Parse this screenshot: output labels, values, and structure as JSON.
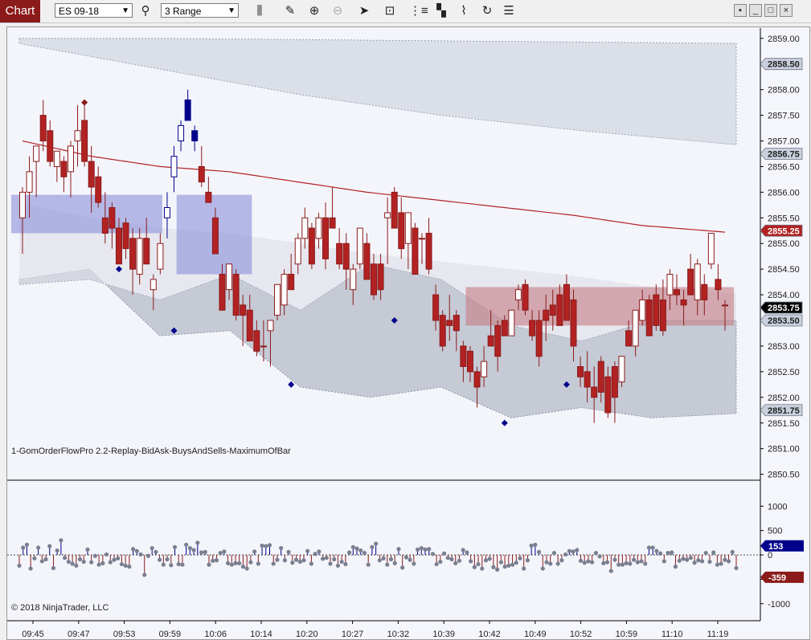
{
  "toolbar": {
    "chart_tab": "Chart",
    "instrument": "ES 09-18",
    "interval": "3 Range",
    "icons": [
      "bars-type-icon",
      "pencil-draw-icon",
      "zoom-in-icon",
      "zoom-out-icon",
      "pointer-icon",
      "data-box-icon",
      "properties-icon",
      "strategies-icon",
      "indicators-icon",
      "reload-icon",
      "template-list-icon"
    ]
  },
  "window_buttons": {
    "minimize": "_",
    "maximize": "□",
    "close": "×"
  },
  "price_axis": {
    "ticks": [
      "2859.00",
      "2858.50",
      "2858.00",
      "2857.50",
      "2857.00",
      "2856.50",
      "2856.00",
      "2855.50",
      "2855.00",
      "2854.50",
      "2854.00",
      "2853.50",
      "2853.00",
      "2852.50",
      "2852.00",
      "2851.50",
      "2851.00",
      "2850.50"
    ],
    "markers": [
      {
        "value": "2858.50",
        "color": "#c9d0dc",
        "dark": false
      },
      {
        "value": "2856.75",
        "color": "#c9d0dc",
        "dark": false
      },
      {
        "value": "2855.25",
        "color": "#b22222",
        "dark": true
      },
      {
        "value": "2853.75",
        "color": "#000000",
        "dark": true
      },
      {
        "value": "2853.50",
        "color": "#c9d0dc",
        "dark": false
      },
      {
        "value": "2851.75",
        "color": "#c9d0dc",
        "dark": false
      }
    ]
  },
  "indicator_axis": {
    "ticks": [
      "1000",
      "500",
      "0",
      "-500",
      "-1000"
    ],
    "markers": [
      {
        "value": "153",
        "color": "#00008b"
      },
      {
        "value": "-359",
        "color": "#8b1a1a"
      }
    ]
  },
  "time_axis": [
    "09:45",
    "09:47",
    "09:53",
    "09:59",
    "10:06",
    "10:14",
    "10:20",
    "10:27",
    "10:32",
    "10:39",
    "10:42",
    "10:49",
    "10:52",
    "10:59",
    "11:10",
    "11:19"
  ],
  "plot_label": "1-GomOrderFlowPro 2.2-Replay-BidAsk-BuysAndSells-MaximumOfBar",
  "copyright": "© 2018 NinjaTrader, LLC",
  "colors": {
    "up": "#ffffff",
    "down": "#b22222",
    "band": "#c7ccd6",
    "zone_blue": "#8b90d8",
    "zone_red": "#c47c84",
    "vwap": "#b22222"
  },
  "chart_data": {
    "type": "candlestick",
    "symbol": "ES 09-18",
    "bar_type": "3 Range",
    "price_range": [
      2850.4,
      2859.2
    ],
    "indicator_range": [
      -1350,
      1500
    ],
    "candles": [
      [
        2855.5,
        2856.1,
        2854.8,
        2856.0
      ],
      [
        2856.0,
        2856.7,
        2855.5,
        2856.4
      ],
      [
        2856.6,
        2856.8,
        2855.9,
        2856.9
      ],
      [
        2857.5,
        2857.8,
        2856.8,
        2857.0
      ],
      [
        2857.2,
        2857.4,
        2856.5,
        2856.6
      ],
      [
        2856.5,
        2856.8,
        2856.2,
        2856.8
      ],
      [
        2856.6,
        2856.7,
        2856.0,
        2856.3
      ],
      [
        2856.4,
        2857.0,
        2855.9,
        2856.9
      ],
      [
        2857.0,
        2857.7,
        2856.5,
        2857.2
      ],
      [
        2857.4,
        2857.8,
        2856.5,
        2856.6
      ],
      [
        2856.6,
        2856.9,
        2855.6,
        2856.1
      ],
      [
        2856.3,
        2856.5,
        2855.7,
        2855.8
      ],
      [
        2855.5,
        2856.0,
        2855.0,
        2855.2
      ],
      [
        2855.7,
        2855.8,
        2854.9,
        2855.3
      ],
      [
        2855.3,
        2855.5,
        2854.6,
        2854.6
      ],
      [
        2855.4,
        2855.5,
        2854.7,
        2854.9
      ],
      [
        2855.1,
        2855.3,
        2854.0,
        2854.5
      ],
      [
        2854.4,
        2855.3,
        2854.2,
        2855.1
      ],
      [
        2855.1,
        2855.5,
        2854.6,
        2854.6
      ],
      [
        2854.1,
        2854.4,
        2853.7,
        2854.3
      ],
      [
        2854.5,
        2855.2,
        2854.4,
        2855.0
      ],
      [
        2855.5,
        2856.0,
        2855.1,
        2855.7
      ],
      [
        2856.3,
        2856.9,
        2856.0,
        2856.7
      ],
      [
        2857.0,
        2857.4,
        2856.8,
        2857.3
      ],
      [
        2857.8,
        2858.0,
        2857.4,
        2857.4
      ],
      [
        2857.2,
        2857.3,
        2856.8,
        2857.0
      ],
      [
        2856.5,
        2856.9,
        2856.1,
        2856.2
      ],
      [
        2856.0,
        2856.3,
        2855.8,
        2855.8
      ],
      [
        2855.5,
        2855.7,
        2854.8,
        2854.8
      ],
      [
        2854.4,
        2854.6,
        2853.7,
        2853.7
      ],
      [
        2854.1,
        2854.6,
        2853.9,
        2854.6
      ],
      [
        2854.4,
        2854.5,
        2853.5,
        2853.6
      ],
      [
        2853.8,
        2854.0,
        2853.0,
        2853.6
      ],
      [
        2853.7,
        2854.0,
        2853.1,
        2853.1
      ],
      [
        2853.3,
        2853.5,
        2852.8,
        2852.9
      ],
      [
        2853.0,
        2853.5,
        2852.7,
        2853.0
      ],
      [
        2853.3,
        2853.5,
        2852.6,
        2853.5
      ],
      [
        2853.6,
        2854.2,
        2853.5,
        2854.2
      ],
      [
        2853.8,
        2854.5,
        2853.6,
        2854.4
      ],
      [
        2854.4,
        2854.8,
        2854.1,
        2854.1
      ],
      [
        2854.6,
        2855.2,
        2854.4,
        2855.1
      ],
      [
        2855.1,
        2855.7,
        2854.9,
        2855.5
      ],
      [
        2855.3,
        2855.4,
        2854.5,
        2854.6
      ],
      [
        2855.1,
        2855.6,
        2854.9,
        2855.5
      ],
      [
        2855.5,
        2855.8,
        2854.5,
        2854.7
      ],
      [
        2855.5,
        2856.1,
        2855.3,
        2855.3
      ],
      [
        2855.0,
        2855.3,
        2854.5,
        2854.6
      ],
      [
        2855.0,
        2855.2,
        2854.1,
        2854.5
      ],
      [
        2854.1,
        2854.6,
        2853.8,
        2854.5
      ],
      [
        2854.6,
        2855.3,
        2854.5,
        2855.3
      ],
      [
        2855.0,
        2855.2,
        2854.3,
        2854.3
      ],
      [
        2854.6,
        2854.8,
        2853.9,
        2854.0
      ],
      [
        2854.6,
        2854.8,
        2853.9,
        2854.1
      ],
      [
        2855.5,
        2855.9,
        2854.6,
        2855.6
      ],
      [
        2856.0,
        2856.1,
        2855.3,
        2855.3
      ],
      [
        2855.6,
        2855.9,
        2854.7,
        2854.9
      ],
      [
        2855.0,
        2855.6,
        2854.5,
        2855.6
      ],
      [
        2855.3,
        2855.4,
        2854.4,
        2854.4
      ],
      [
        2855.1,
        2855.2,
        2854.6,
        2855.1
      ],
      [
        2855.2,
        2855.5,
        2854.4,
        2854.5
      ],
      [
        2854.0,
        2854.2,
        2853.3,
        2853.5
      ],
      [
        2853.6,
        2853.7,
        2852.9,
        2853.0
      ],
      [
        2853.5,
        2854.0,
        2853.1,
        2853.4
      ],
      [
        2853.6,
        2853.7,
        2852.9,
        2853.3
      ],
      [
        2853.0,
        2853.1,
        2852.3,
        2852.6
      ],
      [
        2852.9,
        2853.0,
        2852.3,
        2852.5
      ],
      [
        2852.5,
        2852.6,
        2851.8,
        2852.2
      ],
      [
        2852.4,
        2853.0,
        2852.2,
        2852.7
      ],
      [
        2853.2,
        2853.7,
        2853.0,
        2853.0
      ],
      [
        2853.4,
        2853.5,
        2852.5,
        2852.8
      ],
      [
        2853.5,
        2853.6,
        2853.2,
        2853.2
      ],
      [
        2853.2,
        2853.7,
        2853.2,
        2853.7
      ],
      [
        2853.9,
        2854.2,
        2853.7,
        2854.1
      ],
      [
        2854.2,
        2854.3,
        2853.6,
        2853.7
      ],
      [
        2853.5,
        2853.7,
        2853.1,
        2853.2
      ],
      [
        2853.5,
        2853.7,
        2852.6,
        2852.8
      ],
      [
        2853.7,
        2854.0,
        2853.1,
        2853.5
      ],
      [
        2853.8,
        2854.1,
        2853.3,
        2853.6
      ],
      [
        2854.0,
        2854.2,
        2853.4,
        2853.4
      ],
      [
        2854.2,
        2854.4,
        2853.5,
        2853.5
      ],
      [
        2853.9,
        2854.1,
        2852.7,
        2853.0
      ],
      [
        2852.6,
        2852.8,
        2852.2,
        2852.4
      ],
      [
        2852.5,
        2852.9,
        2851.9,
        2852.2
      ],
      [
        2852.2,
        2852.6,
        2851.5,
        2852.0
      ],
      [
        2852.7,
        2852.8,
        2851.9,
        2852.1
      ],
      [
        2852.4,
        2852.6,
        2851.6,
        2851.7
      ],
      [
        2852.6,
        2852.7,
        2851.5,
        2852.0
      ],
      [
        2852.3,
        2852.8,
        2852.2,
        2852.8
      ],
      [
        2853.3,
        2853.5,
        2853.0,
        2853.0
      ],
      [
        2853.0,
        2853.7,
        2852.8,
        2853.7
      ],
      [
        2853.5,
        2854.1,
        2853.4,
        2853.9
      ],
      [
        2853.9,
        2854.0,
        2853.2,
        2853.2
      ],
      [
        2854.0,
        2854.2,
        2853.3,
        2853.4
      ],
      [
        2853.9,
        2854.3,
        2853.2,
        2853.3
      ],
      [
        2854.0,
        2854.5,
        2853.7,
        2854.4
      ],
      [
        2854.1,
        2854.4,
        2853.8,
        2854.0
      ],
      [
        2853.9,
        2854.1,
        2853.4,
        2853.8
      ],
      [
        2854.5,
        2854.8,
        2854.0,
        2854.0
      ],
      [
        2853.9,
        2854.7,
        2853.6,
        2854.6
      ],
      [
        2854.2,
        2854.4,
        2853.6,
        2853.9
      ],
      [
        2854.6,
        2855.2,
        2854.5,
        2855.2
      ],
      [
        2854.3,
        2854.6,
        2853.9,
        2854.1
      ],
      [
        2853.8,
        2853.9,
        2853.3,
        2853.8
      ]
    ],
    "delta": [
      -220,
      150,
      210,
      -280,
      -70,
      150,
      -130,
      -90,
      180,
      -270,
      90,
      300,
      -60,
      -140,
      -180,
      -220,
      -90,
      -140,
      110,
      -150,
      -20,
      -200,
      -170,
      10,
      -150,
      -100,
      -70,
      -190,
      -220,
      -240,
      120,
      80,
      10,
      -410,
      -20,
      140,
      60,
      -100,
      -200,
      -90,
      -210,
      160,
      -190,
      -200,
      210,
      140,
      100,
      250,
      50,
      60,
      -200,
      -120,
      -110,
      40,
      70,
      -170,
      -200,
      -170,
      -170,
      -240,
      -280,
      -150,
      70,
      -180,
      190,
      180,
      200,
      -180,
      -100,
      140,
      -110,
      60,
      -160,
      -100,
      -140,
      -110,
      80,
      -180,
      20,
      70,
      -80,
      -60,
      -180,
      -90,
      -220,
      -140,
      -190,
      50,
      160,
      130,
      90,
      40,
      -200,
      160,
      230,
      -110,
      -70,
      -200,
      -90,
      -170,
      120,
      -260,
      -50,
      -100,
      -180,
      110,
      140,
      110,
      120,
      20,
      -190,
      -140,
      30,
      -60,
      -90,
      -170,
      -120,
      100,
      50,
      -130,
      -250,
      -190,
      -280,
      -110,
      -80,
      -250,
      -300,
      -150,
      -240,
      -220,
      -200,
      -160,
      -70,
      -280,
      -110,
      190,
      210,
      60,
      -280,
      -150,
      -180,
      40,
      -180,
      -110,
      10,
      80,
      70,
      100,
      -120,
      -160,
      -130,
      -150,
      40,
      -30,
      -170,
      -150,
      -330,
      -100,
      -200,
      -200,
      -170,
      -180,
      -100,
      -150,
      -130,
      -180,
      150,
      150,
      80,
      30,
      -130,
      40,
      50,
      -240,
      -120,
      -80,
      -100,
      -60,
      -160,
      -110,
      -130,
      40,
      -140,
      50,
      -200,
      -180,
      -100,
      -130,
      60,
      -270
    ],
    "vwap": [
      [
        0,
        2857.0
      ],
      [
        10,
        2856.7
      ],
      [
        20,
        2856.5
      ],
      [
        30,
        2856.4
      ],
      [
        40,
        2856.2
      ],
      [
        50,
        2856.0
      ],
      [
        60,
        2855.85
      ],
      [
        70,
        2855.7
      ],
      [
        80,
        2855.55
      ],
      [
        90,
        2855.35
      ],
      [
        104,
        2855.2
      ]
    ],
    "band_outer_upper": [
      [
        0,
        2858.9
      ],
      [
        20,
        2858.4
      ],
      [
        40,
        2857.9
      ],
      [
        60,
        2857.5
      ],
      [
        80,
        2857.2
      ],
      [
        104,
        2856.9
      ]
    ],
    "band_inner_upper": [
      [
        0,
        2859.0
      ],
      [
        20,
        2859.0
      ],
      [
        104,
        2858.9
      ]
    ],
    "band_inner_lower": [
      [
        0,
        2854.2
      ],
      [
        10,
        2854.3
      ],
      [
        20,
        2853.9
      ],
      [
        30,
        2854.4
      ],
      [
        40,
        2853.7
      ],
      [
        50,
        2854.6
      ],
      [
        60,
        2854.3
      ],
      [
        70,
        2853.4
      ],
      [
        80,
        2853.1
      ],
      [
        90,
        2853.5
      ],
      [
        104,
        2853.5
      ]
    ],
    "band_outer_lower": [
      [
        0,
        2854.3
      ],
      [
        10,
        2854.5
      ],
      [
        20,
        2853.2
      ],
      [
        30,
        2853.3
      ],
      [
        40,
        2852.2
      ],
      [
        50,
        2852.0
      ],
      [
        60,
        2852.2
      ],
      [
        70,
        2851.6
      ],
      [
        80,
        2851.8
      ],
      [
        90,
        2851.6
      ],
      [
        104,
        2851.7
      ]
    ],
    "zones": [
      {
        "from": 0,
        "to": 21,
        "top": 2855.95,
        "bottom": 2855.2,
        "color": "blue"
      },
      {
        "from": 24,
        "to": 34,
        "top": 2855.95,
        "bottom": 2854.4,
        "color": "blue"
      },
      {
        "from": 66,
        "to": 104,
        "top": 2854.15,
        "bottom": 2853.4,
        "color": "red"
      }
    ],
    "markers": [
      {
        "i": 9,
        "price": 2857.75,
        "color": "#8b1a1a"
      },
      {
        "i": 14,
        "price": 2854.5,
        "color": "#00008b"
      },
      {
        "i": 22,
        "price": 2853.3,
        "color": "#00008b"
      },
      {
        "i": 39,
        "price": 2852.25,
        "color": "#00008b"
      },
      {
        "i": 54,
        "price": 2853.5,
        "color": "#00008b"
      },
      {
        "i": 70,
        "price": 2851.5,
        "color": "#00008b"
      },
      {
        "i": 79,
        "price": 2852.25,
        "color": "#00008b"
      }
    ]
  }
}
